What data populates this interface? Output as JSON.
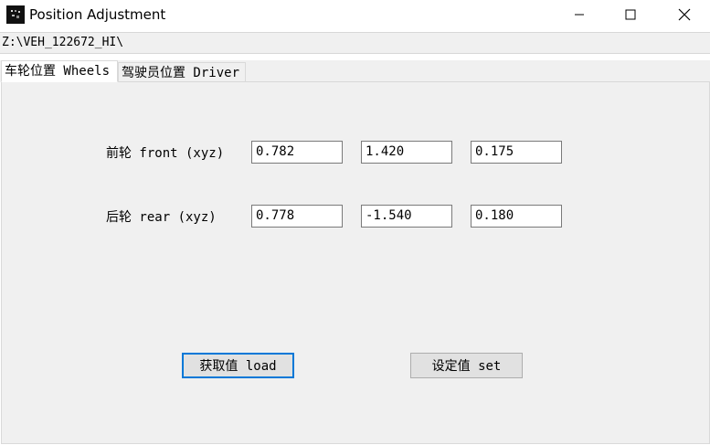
{
  "window": {
    "title": "Position Adjustment",
    "minimize_symbol": "—",
    "maximize_symbol": "☐",
    "close_symbol": "✕"
  },
  "path": "Z:\\VEH_122672_HI\\",
  "tabs": [
    {
      "label": "车轮位置 Wheels",
      "active": true
    },
    {
      "label": "驾驶员位置 Driver",
      "active": false
    }
  ],
  "wheels": {
    "front_label": "前轮 front (xyz)",
    "front_values": [
      "0.782",
      "1.420",
      "0.175"
    ],
    "rear_label": "后轮 rear (xyz)",
    "rear_values": [
      "0.778",
      "-1.540",
      "0.180"
    ]
  },
  "buttons": {
    "load_label": "获取值 load",
    "set_label": "设定值 set"
  },
  "icons": {
    "app": "app-icon",
    "minimize": "minimize-icon",
    "maximize": "maximize-icon",
    "close": "close-icon"
  },
  "colors": {
    "panel_bg": "#f0f0f0",
    "default_button_border": "#0078d7"
  }
}
